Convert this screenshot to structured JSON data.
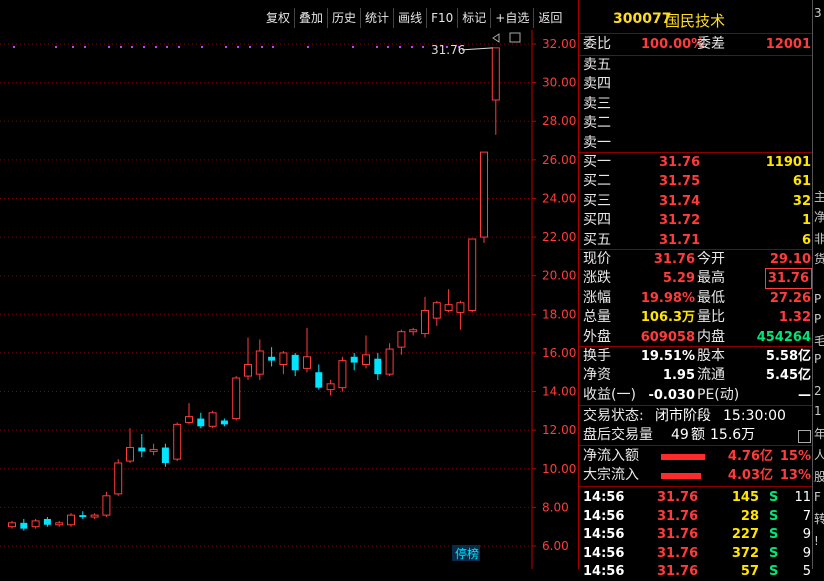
{
  "toolbar": {
    "items": [
      "复权",
      "叠加",
      "历史",
      "统计",
      "画线",
      "F10",
      "标记",
      "+自选",
      "返回"
    ]
  },
  "chart_data": {
    "type": "candlestick",
    "ylim": [
      5.5,
      32.5
    ],
    "yticks": [
      "32.00",
      "30.00",
      "28.00",
      "26.00",
      "24.00",
      "22.00",
      "20.00",
      "18.00",
      "16.00",
      "14.00",
      "12.00",
      "10.00",
      "8.00",
      "6.00"
    ],
    "ytick_values": [
      32,
      30,
      28,
      26,
      24,
      22,
      20,
      18,
      16,
      14,
      12,
      10,
      8,
      6
    ],
    "candles": [
      {
        "o": 7.0,
        "c": 7.2,
        "h": 7.3,
        "l": 6.9
      },
      {
        "o": 7.2,
        "c": 6.9,
        "h": 7.4,
        "l": 6.8
      },
      {
        "o": 7.0,
        "c": 7.3,
        "h": 7.4,
        "l": 6.9
      },
      {
        "o": 7.4,
        "c": 7.1,
        "h": 7.5,
        "l": 7.0
      },
      {
        "o": 7.1,
        "c": 7.2,
        "h": 7.3,
        "l": 7.0
      },
      {
        "o": 7.1,
        "c": 7.6,
        "h": 7.7,
        "l": 7.0
      },
      {
        "o": 7.6,
        "c": 7.5,
        "h": 7.8,
        "l": 7.4
      },
      {
        "o": 7.5,
        "c": 7.6,
        "h": 7.7,
        "l": 7.4
      },
      {
        "o": 7.6,
        "c": 8.6,
        "h": 8.8,
        "l": 7.5
      },
      {
        "o": 8.7,
        "c": 10.3,
        "h": 10.5,
        "l": 8.6
      },
      {
        "o": 10.4,
        "c": 11.1,
        "h": 12.1,
        "l": 10.3
      },
      {
        "o": 11.1,
        "c": 10.9,
        "h": 11.8,
        "l": 10.6
      },
      {
        "o": 10.9,
        "c": 11.0,
        "h": 11.3,
        "l": 10.7
      },
      {
        "o": 11.1,
        "c": 10.3,
        "h": 11.3,
        "l": 10.1
      },
      {
        "o": 10.5,
        "c": 12.3,
        "h": 12.4,
        "l": 10.4
      },
      {
        "o": 12.4,
        "c": 12.7,
        "h": 13.4,
        "l": 12.3
      },
      {
        "o": 12.6,
        "c": 12.2,
        "h": 12.9,
        "l": 12.1
      },
      {
        "o": 12.2,
        "c": 12.9,
        "h": 13.0,
        "l": 12.1
      },
      {
        "o": 12.5,
        "c": 12.3,
        "h": 12.6,
        "l": 12.2
      },
      {
        "o": 12.6,
        "c": 14.7,
        "h": 14.8,
        "l": 12.5
      },
      {
        "o": 14.8,
        "c": 15.4,
        "h": 16.8,
        "l": 14.6
      },
      {
        "o": 14.9,
        "c": 16.1,
        "h": 16.7,
        "l": 14.6
      },
      {
        "o": 15.8,
        "c": 15.6,
        "h": 16.3,
        "l": 15.3
      },
      {
        "o": 15.4,
        "c": 16.0,
        "h": 16.1,
        "l": 14.9
      },
      {
        "o": 15.9,
        "c": 15.1,
        "h": 16.0,
        "l": 14.8
      },
      {
        "o": 15.2,
        "c": 15.8,
        "h": 17.3,
        "l": 15.0
      },
      {
        "o": 15.0,
        "c": 14.2,
        "h": 15.4,
        "l": 14.1
      },
      {
        "o": 14.1,
        "c": 14.4,
        "h": 14.6,
        "l": 13.8
      },
      {
        "o": 14.2,
        "c": 15.6,
        "h": 15.8,
        "l": 14.0
      },
      {
        "o": 15.8,
        "c": 15.5,
        "h": 16.0,
        "l": 15.1
      },
      {
        "o": 15.4,
        "c": 15.9,
        "h": 16.9,
        "l": 15.2
      },
      {
        "o": 15.7,
        "c": 14.9,
        "h": 16.0,
        "l": 14.6
      },
      {
        "o": 14.9,
        "c": 16.2,
        "h": 16.5,
        "l": 14.8
      },
      {
        "o": 16.3,
        "c": 17.1,
        "h": 17.2,
        "l": 15.9
      },
      {
        "o": 17.1,
        "c": 17.2,
        "h": 17.3,
        "l": 16.9
      },
      {
        "o": 17.0,
        "c": 18.2,
        "h": 18.9,
        "l": 16.8
      },
      {
        "o": 17.8,
        "c": 18.6,
        "h": 18.7,
        "l": 17.4
      },
      {
        "o": 18.2,
        "c": 18.5,
        "h": 19.3,
        "l": 18.1
      },
      {
        "o": 18.1,
        "c": 18.6,
        "h": 18.7,
        "l": 17.2
      },
      {
        "o": 18.2,
        "c": 21.9,
        "h": 21.9,
        "l": 18.1
      },
      {
        "o": 22.0,
        "c": 26.4,
        "h": 26.4,
        "l": 21.7
      },
      {
        "o": 29.1,
        "c": 31.8,
        "h": 31.8,
        "l": 27.3
      }
    ],
    "highest_label": "31.76"
  },
  "chart_badge": "停榜",
  "panel": {
    "code": "300077",
    "name": "国民技术",
    "weibi": {
      "label": "委比",
      "value": "100.00%",
      "label2": "委差",
      "value2": "12001"
    },
    "sell": [
      {
        "label": "卖五",
        "price": "",
        "vol": ""
      },
      {
        "label": "卖四",
        "price": "",
        "vol": ""
      },
      {
        "label": "卖三",
        "price": "",
        "vol": ""
      },
      {
        "label": "卖二",
        "price": "",
        "vol": ""
      },
      {
        "label": "卖一",
        "price": "",
        "vol": ""
      }
    ],
    "buy": [
      {
        "label": "买一",
        "price": "31.76",
        "vol": "11901"
      },
      {
        "label": "买二",
        "price": "31.75",
        "vol": "61"
      },
      {
        "label": "买三",
        "price": "31.74",
        "vol": "32"
      },
      {
        "label": "买四",
        "price": "31.72",
        "vol": "1"
      },
      {
        "label": "买五",
        "price": "31.71",
        "vol": "6"
      }
    ],
    "quote": [
      {
        "l1": "现价",
        "v1": "31.76",
        "l2": "今开",
        "v2": "29.10"
      },
      {
        "l1": "涨跌",
        "v1": "5.29",
        "l2": "最高",
        "v2": "31.76"
      },
      {
        "l1": "涨幅",
        "v1": "19.98%",
        "l2": "最低",
        "v2": "27.26"
      },
      {
        "l1": "总量",
        "v1": "106.3万",
        "l2": "量比",
        "v2": "1.32"
      },
      {
        "l1": "外盘",
        "v1": "609058",
        "l2": "内盘",
        "v2": "454264"
      }
    ],
    "stats": [
      {
        "l1": "换手",
        "v1": "19.51%",
        "l2": "股本",
        "v2": "5.58亿"
      },
      {
        "l1": "净资",
        "v1": "1.95",
        "l2": "流通",
        "v2": "5.45亿"
      },
      {
        "l1": "收益(一)",
        "v1": "-0.030",
        "l2": "PE(动)",
        "v2": "—"
      }
    ],
    "status": {
      "label": "交易状态:",
      "value": "闭市阶段",
      "time": "15:30:00"
    },
    "after": {
      "label": "盘后交易量",
      "vol": "49",
      "amt_label": "额",
      "amt": "15.6万"
    },
    "flows": [
      {
        "label": "净流入额",
        "value": "4.76亿",
        "pct": "15%"
      },
      {
        "label": "大宗流入",
        "value": "4.03亿",
        "pct": "13%"
      }
    ],
    "ticks": [
      {
        "time": "14:56",
        "price": "31.76",
        "vol": "145",
        "side": "S",
        "n": "11"
      },
      {
        "time": "14:56",
        "price": "31.76",
        "vol": "28",
        "side": "S",
        "n": "7"
      },
      {
        "time": "14:56",
        "price": "31.76",
        "vol": "227",
        "side": "S",
        "n": "9"
      },
      {
        "time": "14:56",
        "price": "31.76",
        "vol": "372",
        "side": "S",
        "n": "9"
      },
      {
        "time": "14:56",
        "price": "31.76",
        "vol": "57",
        "side": "S",
        "n": "5"
      }
    ]
  },
  "strip": [
    "3",
    "主",
    "净",
    "非",
    "货",
    "P",
    "P",
    "毛",
    "P",
    "2",
    "1",
    "年",
    "人",
    "股",
    "F",
    "转",
    "!"
  ],
  "colors": {
    "up": "#ff3b3b",
    "down": "#00e5ff",
    "grid": "#8a0000",
    "axis": "#c00000"
  }
}
